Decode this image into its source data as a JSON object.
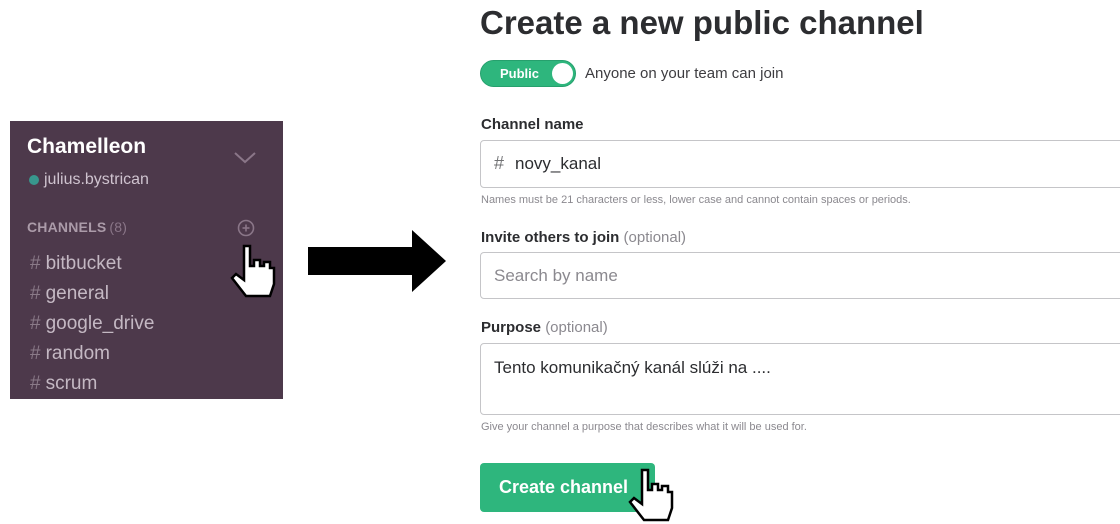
{
  "sidebar": {
    "team_name": "Chamelleon",
    "username": "julius.bystrican",
    "channels_header": "CHANNELS",
    "channels_count": "(8)",
    "channels": [
      {
        "hash": "#",
        "name": "bitbucket"
      },
      {
        "hash": "#",
        "name": "general"
      },
      {
        "hash": "#",
        "name": "google_drive"
      },
      {
        "hash": "#",
        "name": "random"
      },
      {
        "hash": "#",
        "name": "scrum"
      }
    ],
    "colors": {
      "background": "#4d394b",
      "presence": "#38978d"
    }
  },
  "form": {
    "title": "Create a new public channel",
    "toggle_label": "Public",
    "toggle_description": "Anyone on your team can join",
    "channel_name_label": "Channel name",
    "channel_name_hash": "#",
    "channel_name_value": "novy_kanal",
    "channel_name_hint": "Names must be 21 characters or less, lower case and cannot contain spaces or periods.",
    "invite_label": "Invite others to join",
    "invite_optional": "(optional)",
    "invite_placeholder": "Search by name",
    "purpose_label": "Purpose",
    "purpose_optional": "(optional)",
    "purpose_value": "Tento komunikačný kanál slúži na ....",
    "purpose_hint": "Give your channel a purpose that describes what it will be used for.",
    "create_button": "Create channel",
    "colors": {
      "accent": "#2eb67d"
    }
  },
  "icons": {
    "team_menu": "chevron-down-icon",
    "add_channel": "add-circle-icon",
    "cursor": "hand-pointer-icon",
    "flow": "right-arrow-icon"
  }
}
